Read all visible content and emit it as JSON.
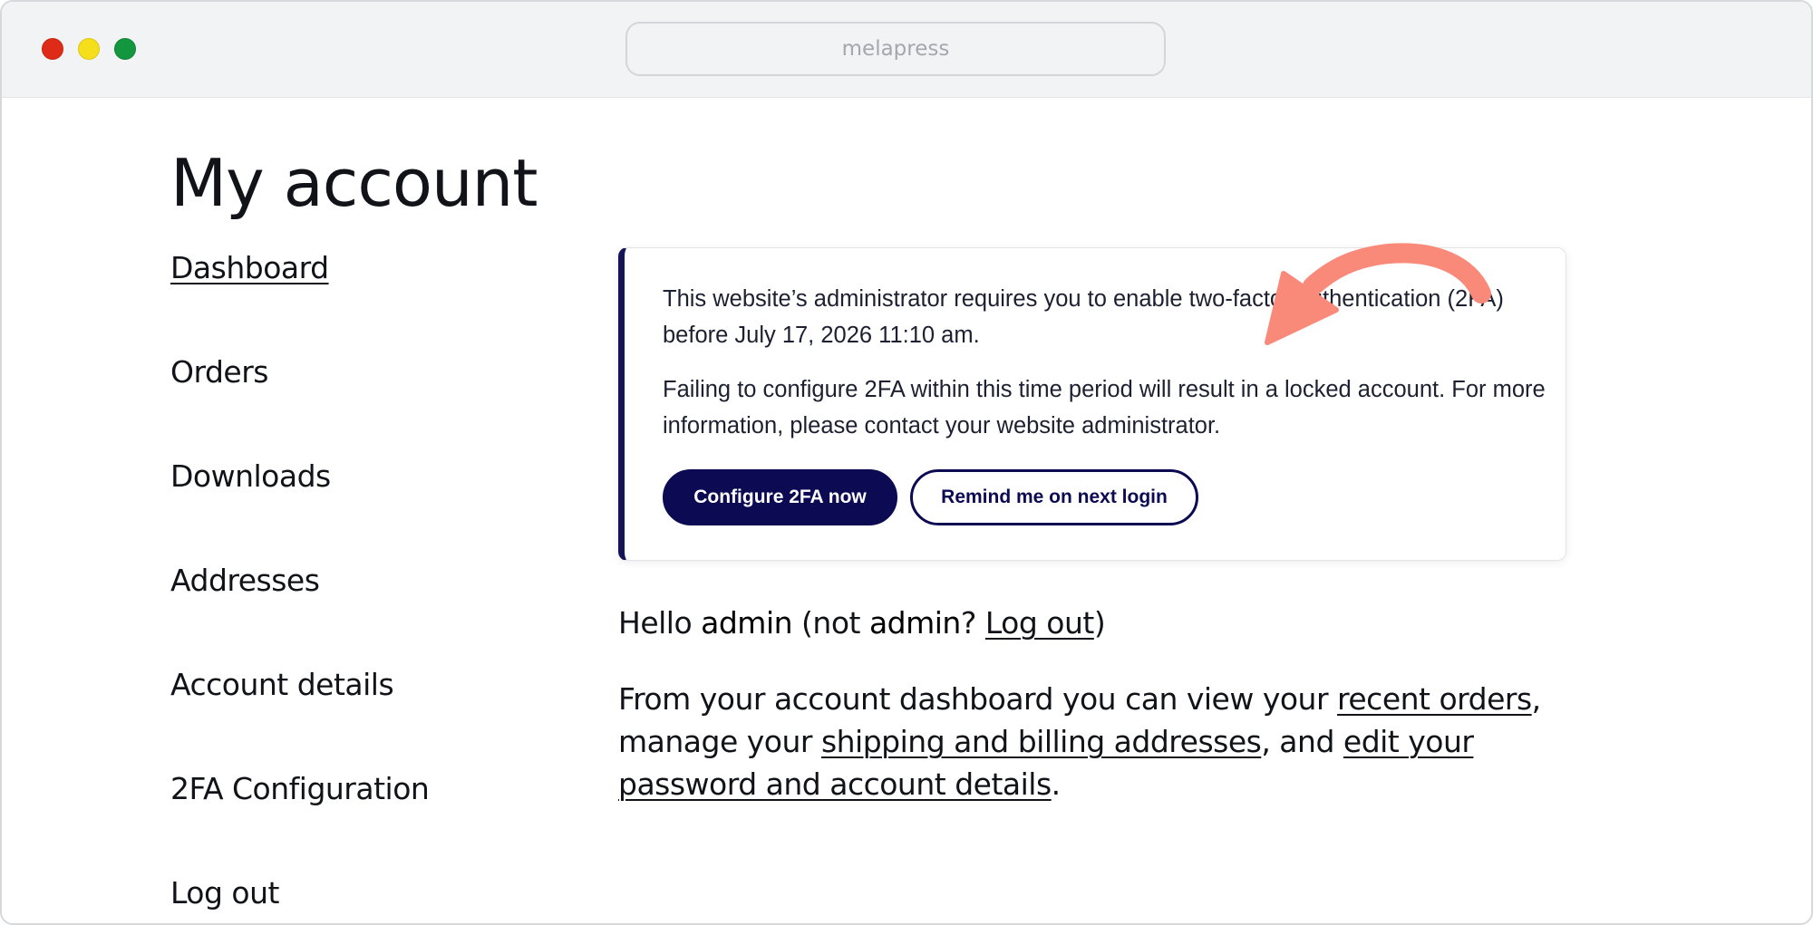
{
  "browser": {
    "address": "melapress"
  },
  "page": {
    "title": "My account"
  },
  "nav": {
    "items": [
      {
        "label": "Dashboard",
        "active": true
      },
      {
        "label": "Orders"
      },
      {
        "label": "Downloads"
      },
      {
        "label": "Addresses"
      },
      {
        "label": "Account details"
      },
      {
        "label": "2FA Configuration"
      },
      {
        "label": "Log out"
      }
    ]
  },
  "notice": {
    "line1": "This website’s administrator requires you to enable two-factor authentication (2FA) before July 17, 2026 11:10 am.",
    "line2": "Failing to configure 2FA within this time period will result in a locked account. For more information, please contact your website administrator.",
    "primary_button": "Configure 2FA now",
    "secondary_button": "Remind me on next login",
    "accent_color": "#0c0a52",
    "arrow_color": "#f98a7a"
  },
  "greeting": {
    "hello": "Hello ",
    "username": "admin",
    "not_prefix": " (not ",
    "not_username": "admin",
    "question": "? ",
    "logout_link": "Log out",
    "close": ")"
  },
  "intro": {
    "text1": "From your account dashboard you can view your ",
    "link_orders": "recent orders",
    "text2": ", manage your ",
    "link_addresses": "shipping and billing addresses",
    "text3": ", and ",
    "link_account": "edit your password and account details",
    "text4": "."
  }
}
